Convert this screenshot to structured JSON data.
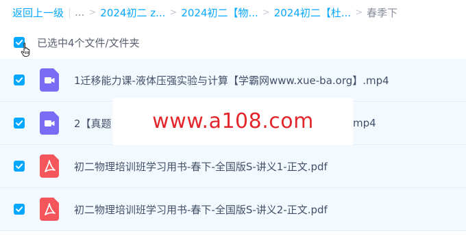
{
  "breadcrumb": {
    "back_label": "返回上一级",
    "ellipsis": "...",
    "items": [
      "2024初二 z...",
      "2024初二【物...",
      "2024初二【杜..."
    ],
    "current": "春季下"
  },
  "selection": {
    "text": "已选中4个文件/文件夹",
    "checked": true
  },
  "files": [
    {
      "name": "1迁移能力课-液体压强实验与计算【学霸网www.xue-ba.org】.mp4",
      "type": "video",
      "checked": true
    },
    {
      "name": "2【真题",
      "name_tail": "mp4",
      "type": "video",
      "checked": true
    },
    {
      "name": "初二物理培训班学习用书-春下-全国版S-讲义1-正文.pdf",
      "type": "pdf",
      "checked": true
    },
    {
      "name": "初二物理培训班学习用书-春下-全国版S-讲义2-正文.pdf",
      "type": "pdf",
      "checked": true
    }
  ],
  "watermark": {
    "text": "www.a108.com"
  },
  "colors": {
    "accent": "#06a7ff",
    "row_bg": "#f2f9ff",
    "video_icon": "#7b6cf6",
    "pdf_icon": "#f5565b",
    "watermark": "#e3262b"
  },
  "icons": {
    "video": "video-file-icon",
    "pdf": "pdf-file-icon",
    "cursor": "hand-cursor-icon"
  }
}
